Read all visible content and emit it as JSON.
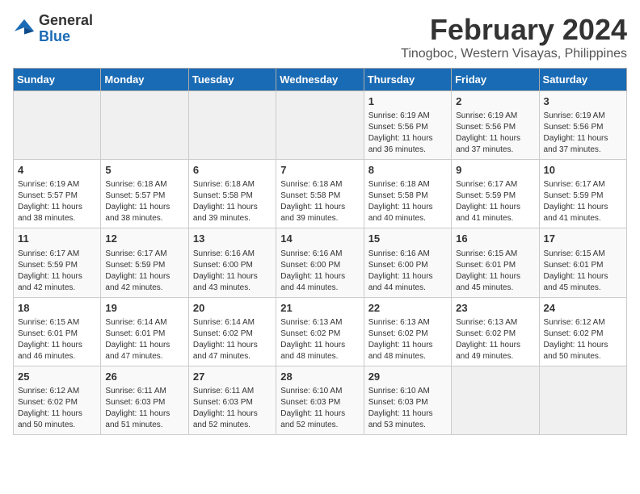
{
  "logo": {
    "general": "General",
    "blue": "Blue"
  },
  "header": {
    "title": "February 2024",
    "subtitle": "Tinogboc, Western Visayas, Philippines"
  },
  "columns": [
    "Sunday",
    "Monday",
    "Tuesday",
    "Wednesday",
    "Thursday",
    "Friday",
    "Saturday"
  ],
  "weeks": [
    [
      {
        "day": "",
        "info": ""
      },
      {
        "day": "",
        "info": ""
      },
      {
        "day": "",
        "info": ""
      },
      {
        "day": "",
        "info": ""
      },
      {
        "day": "1",
        "info": "Sunrise: 6:19 AM\nSunset: 5:56 PM\nDaylight: 11 hours and 36 minutes."
      },
      {
        "day": "2",
        "info": "Sunrise: 6:19 AM\nSunset: 5:56 PM\nDaylight: 11 hours and 37 minutes."
      },
      {
        "day": "3",
        "info": "Sunrise: 6:19 AM\nSunset: 5:56 PM\nDaylight: 11 hours and 37 minutes."
      }
    ],
    [
      {
        "day": "4",
        "info": "Sunrise: 6:19 AM\nSunset: 5:57 PM\nDaylight: 11 hours and 38 minutes."
      },
      {
        "day": "5",
        "info": "Sunrise: 6:18 AM\nSunset: 5:57 PM\nDaylight: 11 hours and 38 minutes."
      },
      {
        "day": "6",
        "info": "Sunrise: 6:18 AM\nSunset: 5:58 PM\nDaylight: 11 hours and 39 minutes."
      },
      {
        "day": "7",
        "info": "Sunrise: 6:18 AM\nSunset: 5:58 PM\nDaylight: 11 hours and 39 minutes."
      },
      {
        "day": "8",
        "info": "Sunrise: 6:18 AM\nSunset: 5:58 PM\nDaylight: 11 hours and 40 minutes."
      },
      {
        "day": "9",
        "info": "Sunrise: 6:17 AM\nSunset: 5:59 PM\nDaylight: 11 hours and 41 minutes."
      },
      {
        "day": "10",
        "info": "Sunrise: 6:17 AM\nSunset: 5:59 PM\nDaylight: 11 hours and 41 minutes."
      }
    ],
    [
      {
        "day": "11",
        "info": "Sunrise: 6:17 AM\nSunset: 5:59 PM\nDaylight: 11 hours and 42 minutes."
      },
      {
        "day": "12",
        "info": "Sunrise: 6:17 AM\nSunset: 5:59 PM\nDaylight: 11 hours and 42 minutes."
      },
      {
        "day": "13",
        "info": "Sunrise: 6:16 AM\nSunset: 6:00 PM\nDaylight: 11 hours and 43 minutes."
      },
      {
        "day": "14",
        "info": "Sunrise: 6:16 AM\nSunset: 6:00 PM\nDaylight: 11 hours and 44 minutes."
      },
      {
        "day": "15",
        "info": "Sunrise: 6:16 AM\nSunset: 6:00 PM\nDaylight: 11 hours and 44 minutes."
      },
      {
        "day": "16",
        "info": "Sunrise: 6:15 AM\nSunset: 6:01 PM\nDaylight: 11 hours and 45 minutes."
      },
      {
        "day": "17",
        "info": "Sunrise: 6:15 AM\nSunset: 6:01 PM\nDaylight: 11 hours and 45 minutes."
      }
    ],
    [
      {
        "day": "18",
        "info": "Sunrise: 6:15 AM\nSunset: 6:01 PM\nDaylight: 11 hours and 46 minutes."
      },
      {
        "day": "19",
        "info": "Sunrise: 6:14 AM\nSunset: 6:01 PM\nDaylight: 11 hours and 47 minutes."
      },
      {
        "day": "20",
        "info": "Sunrise: 6:14 AM\nSunset: 6:02 PM\nDaylight: 11 hours and 47 minutes."
      },
      {
        "day": "21",
        "info": "Sunrise: 6:13 AM\nSunset: 6:02 PM\nDaylight: 11 hours and 48 minutes."
      },
      {
        "day": "22",
        "info": "Sunrise: 6:13 AM\nSunset: 6:02 PM\nDaylight: 11 hours and 48 minutes."
      },
      {
        "day": "23",
        "info": "Sunrise: 6:13 AM\nSunset: 6:02 PM\nDaylight: 11 hours and 49 minutes."
      },
      {
        "day": "24",
        "info": "Sunrise: 6:12 AM\nSunset: 6:02 PM\nDaylight: 11 hours and 50 minutes."
      }
    ],
    [
      {
        "day": "25",
        "info": "Sunrise: 6:12 AM\nSunset: 6:02 PM\nDaylight: 11 hours and 50 minutes."
      },
      {
        "day": "26",
        "info": "Sunrise: 6:11 AM\nSunset: 6:03 PM\nDaylight: 11 hours and 51 minutes."
      },
      {
        "day": "27",
        "info": "Sunrise: 6:11 AM\nSunset: 6:03 PM\nDaylight: 11 hours and 52 minutes."
      },
      {
        "day": "28",
        "info": "Sunrise: 6:10 AM\nSunset: 6:03 PM\nDaylight: 11 hours and 52 minutes."
      },
      {
        "day": "29",
        "info": "Sunrise: 6:10 AM\nSunset: 6:03 PM\nDaylight: 11 hours and 53 minutes."
      },
      {
        "day": "",
        "info": ""
      },
      {
        "day": "",
        "info": ""
      }
    ]
  ]
}
